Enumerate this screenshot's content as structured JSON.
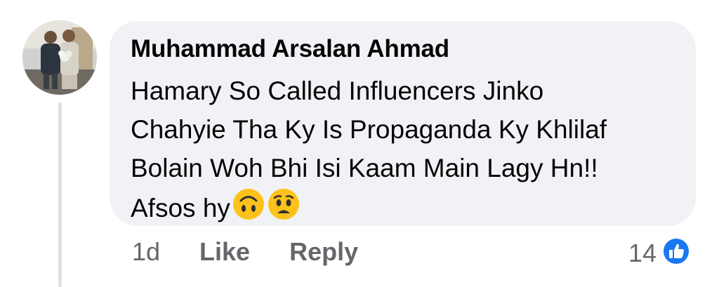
{
  "comment": {
    "author": "Muhammad Arsalan Ahmad",
    "lines": [
      "Hamary So Called Influencers Jinko",
      "Chahyie Tha Ky Is Propaganda Ky Khlilaf",
      "Bolain Woh Bhi Isi Kaam Main Lagy Hn!!",
      "Afsos hy"
    ],
    "emojis": [
      "upside-down-face-icon",
      "worried-face-icon"
    ]
  },
  "actions": {
    "time": "1d",
    "like_label": "Like",
    "reply_label": "Reply"
  },
  "reactions": {
    "count": "14",
    "icon": "like-reaction-icon"
  },
  "colors": {
    "bubble": "#f0f2f5",
    "text": "#050505",
    "secondary": "#65676b",
    "like_blue": "#1877f2",
    "emoji_yellow": "#fcc21b"
  }
}
